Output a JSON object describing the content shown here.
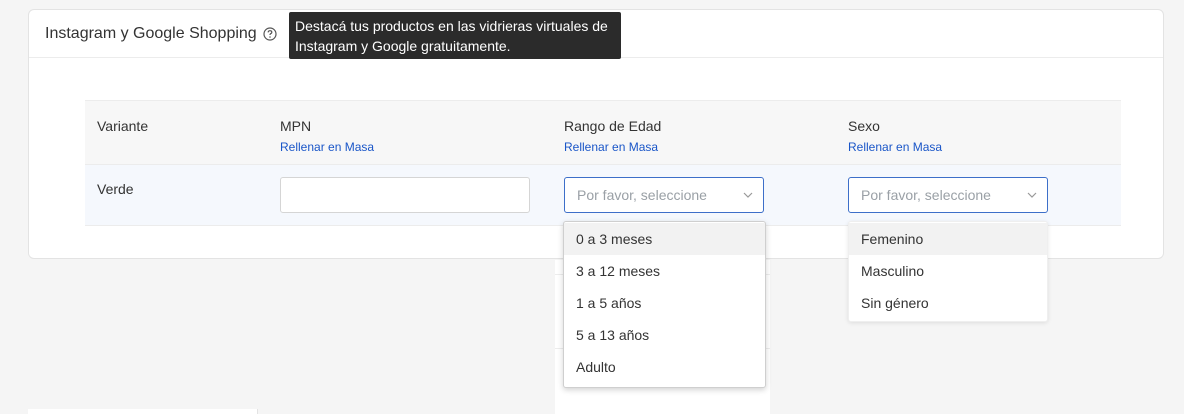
{
  "card": {
    "title": "Instagram y Google Shopping",
    "tooltip": "Destacá tus productos en las vidrieras virtuales de Instagram y Google gratuitamente."
  },
  "table": {
    "headers": {
      "variant": "Variante",
      "mpn": "MPN",
      "age": "Rango de Edad",
      "gender": "Sexo"
    },
    "fill_link": "Rellenar en Masa",
    "row": {
      "variant": "Verde",
      "mpn_value": "",
      "age_placeholder": "Por favor, seleccione",
      "gender_placeholder": "Por favor, seleccione"
    }
  },
  "age_options": [
    "0 a 3 meses",
    "3 a 12 meses",
    "1 a 5 años",
    "5 a 13 años",
    "Adulto"
  ],
  "gender_options": [
    "Femenino",
    "Masculino",
    "Sin género"
  ],
  "colors": {
    "link": "#1a56c8",
    "select_border_active": "#3d6fc9",
    "tooltip_bg": "#2b2b2b"
  }
}
